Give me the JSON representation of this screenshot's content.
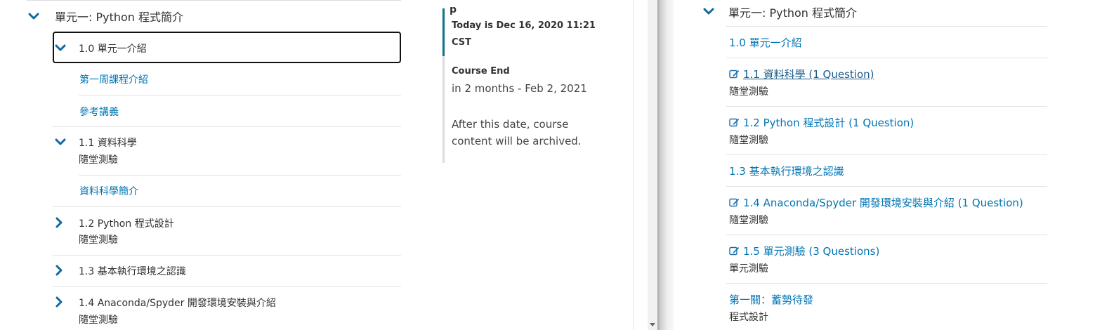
{
  "outline": {
    "section_title": "單元一: Python 程式簡介",
    "subsections": [
      {
        "title": "1.0 單元一介紹",
        "expanded": true,
        "units": [
          "第一周課程介紹",
          "參考講義"
        ]
      },
      {
        "title": "1.1 資料科學",
        "meta": "隨堂測驗",
        "expanded": true,
        "units": [
          "資料科學簡介"
        ]
      },
      {
        "title": "1.2 Python 程式設計",
        "meta": "隨堂測驗",
        "expanded": false
      },
      {
        "title": "1.3 基本執行環境之認識",
        "expanded": false
      },
      {
        "title": "1.4 Anaconda/Spyder 開發環境安裝與介紹",
        "meta": "隨堂測驗",
        "expanded": false
      }
    ]
  },
  "dates": {
    "top_glyph": "p",
    "today": "Today is Dec 16, 2020 11:21 CST",
    "course_end_label": "Course End",
    "course_end_value": "in 2 months - Feb 2, 2021",
    "note": "After this date, course content will be archived."
  },
  "right_outline": {
    "section_title": "單元一: Python 程式簡介",
    "items": [
      {
        "label": "1.0 單元一介紹",
        "icon": "",
        "meta": ""
      },
      {
        "label": "1.1 資料科學 (1 Question)",
        "icon": "edit-icon",
        "meta": "隨堂測驗"
      },
      {
        "label": "1.2 Python 程式設計 (1 Question)",
        "icon": "edit-icon",
        "meta": "隨堂測驗"
      },
      {
        "label": "1.3 基本執行環境之認識",
        "icon": "",
        "meta": ""
      },
      {
        "label": "1.4 Anaconda/Spyder 開發環境安裝與介紹 (1 Question)",
        "icon": "edit-icon",
        "meta": "隨堂測驗"
      },
      {
        "label": "1.5 單元測驗 (3 Questions)",
        "icon": "edit-icon",
        "meta": "單元測驗"
      },
      {
        "label": "第一關：蓄勢待發",
        "icon": "",
        "meta": "程式設計"
      }
    ]
  },
  "colors": {
    "link": "#0075b4",
    "chevron": "#0e6a9e",
    "accent_bar": "#0e7387"
  }
}
